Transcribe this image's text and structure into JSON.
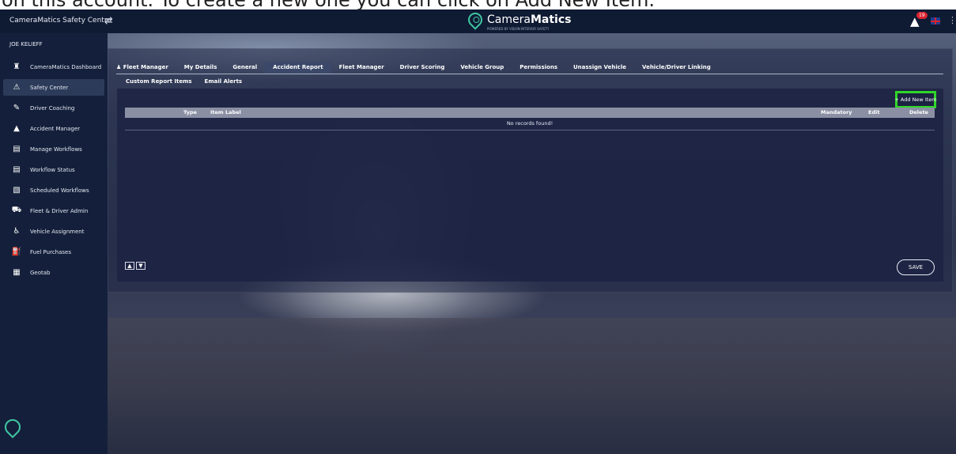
{
  "caption": {
    "text": "on this account. To create a new one you can click on Add New Item."
  },
  "topbar": {
    "title": "CameraMatics Safety Centre",
    "logo_text_light": "Camera",
    "logo_text_bold": "Matics",
    "logo_sub": "POWERED BY VISION INTERIOR SAFETY",
    "alert_count": "19",
    "icons": [
      "swap-icon",
      "alert-icon",
      "flag-uk-icon",
      "kebab-icon"
    ]
  },
  "sidebar": {
    "user": "JOE KELIEFF",
    "items": [
      {
        "label": "CameraMatics Dashboard",
        "icon": "♜",
        "active": false
      },
      {
        "label": "Safety Center",
        "icon": "⚠",
        "active": true
      },
      {
        "label": "Driver Coaching",
        "icon": "✎",
        "active": false
      },
      {
        "label": "Accident Manager",
        "icon": "▲",
        "active": false
      },
      {
        "label": "Manage Workflows",
        "icon": "▤",
        "active": false
      },
      {
        "label": "Workflow Status",
        "icon": "▤",
        "active": false
      },
      {
        "label": "Scheduled Workflows",
        "icon": "▧",
        "active": false
      },
      {
        "label": "Fleet & Driver Admin",
        "icon": "⛟",
        "active": false
      },
      {
        "label": "Vehicle Assignment",
        "icon": "♿",
        "active": false
      },
      {
        "label": "Fuel Purchases",
        "icon": "⛽",
        "active": false
      },
      {
        "label": "Geotab",
        "icon": "▦",
        "active": false
      }
    ]
  },
  "tabs": [
    {
      "label": "Fleet Manager",
      "active": false
    },
    {
      "label": "My Details",
      "active": false
    },
    {
      "label": "General",
      "active": false
    },
    {
      "label": "Accident Report",
      "active": true
    },
    {
      "label": "Fleet Manager",
      "active": false
    },
    {
      "label": "Driver Scoring",
      "active": false
    },
    {
      "label": "Vehicle Group",
      "active": false
    },
    {
      "label": "Permissions",
      "active": false
    },
    {
      "label": "Unassign Vehicle",
      "active": false
    },
    {
      "label": "Vehicle/Driver Linking",
      "active": false
    }
  ],
  "subtabs": [
    "Custom Report Items",
    "Email Alerts"
  ],
  "table": {
    "add_label": "+ Add New Item",
    "columns": {
      "type": "Type",
      "label": "Item Label",
      "mandatory": "Mandatory",
      "edit": "Edit",
      "delete": "Delete"
    },
    "empty_text": "No records found!"
  },
  "footer": {
    "up": "▲",
    "down": "▼",
    "save_label": "SAVE"
  }
}
